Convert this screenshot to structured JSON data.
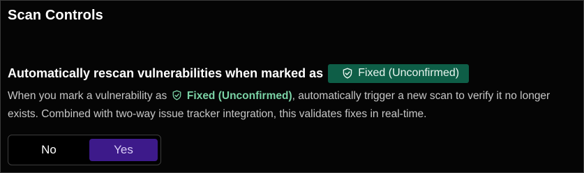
{
  "section": {
    "title": "Scan Controls"
  },
  "setting": {
    "label": "Automatically rescan vulnerabilities when marked as",
    "status_chip": {
      "label": "Fixed (Unconfirmed)",
      "icon": "shield-check-icon",
      "color": "#0e5e47"
    },
    "description": {
      "prefix": "When you mark a vulnerability as",
      "status_label": "Fixed (Unconfirmed)",
      "suffix": ", automatically trigger a new scan to verify it no longer exists. Combined with two-way issue tracker integration, this validates fixes in real-time."
    },
    "toggle": {
      "options": [
        "No",
        "Yes"
      ],
      "selected": "Yes",
      "selected_color": "#3d1a8a"
    }
  }
}
